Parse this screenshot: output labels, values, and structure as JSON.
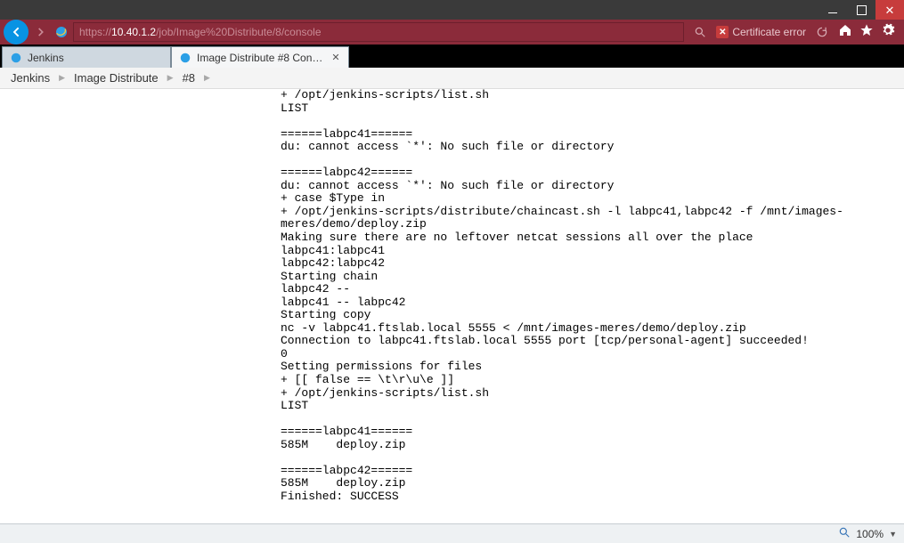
{
  "titlebar": {},
  "address": {
    "protocol": "https://",
    "host": "10.40.1.2",
    "path": "/job/Image%20Distribute/8/console"
  },
  "cert_error": {
    "label": "Certificate error"
  },
  "tabs": [
    {
      "label": "Jenkins"
    },
    {
      "label": "Image Distribute #8 Consol..."
    }
  ],
  "breadcrumb": {
    "items": [
      "Jenkins",
      "Image Distribute",
      "#8"
    ]
  },
  "console_output": "+ /opt/jenkins-scripts/list.sh\nLIST\n\n======labpc41======\ndu: cannot access `*': No such file or directory\n\n======labpc42======\ndu: cannot access `*': No such file or directory\n+ case $Type in\n+ /opt/jenkins-scripts/distribute/chaincast.sh -l labpc41,labpc42 -f /mnt/images-meres/demo/deploy.zip\nMaking sure there are no leftover netcat sessions all over the place\nlabpc41:labpc41\nlabpc42:labpc42\nStarting chain\nlabpc42 --\nlabpc41 -- labpc42\nStarting copy\nnc -v labpc41.ftslab.local 5555 < /mnt/images-meres/demo/deploy.zip\nConnection to labpc41.ftslab.local 5555 port [tcp/personal-agent] succeeded!\n0\nSetting permissions for files\n+ [[ false == \\t\\r\\u\\e ]]\n+ /opt/jenkins-scripts/list.sh\nLIST\n\n======labpc41======\n585M    deploy.zip\n\n======labpc42======\n585M    deploy.zip\nFinished: SUCCESS",
  "statusbar": {
    "zoom": "100%"
  }
}
